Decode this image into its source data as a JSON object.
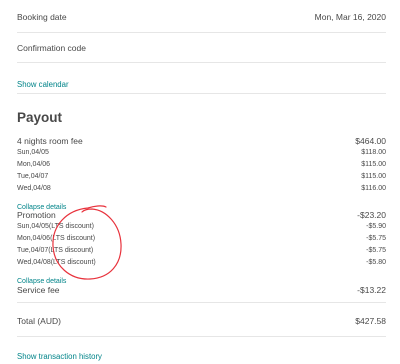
{
  "booking": {
    "date_label": "Booking date",
    "date_value": "Mon, Mar 16, 2020",
    "confirmation_label": "Confirmation code",
    "show_calendar": "Show calendar"
  },
  "payout": {
    "title": "Payout",
    "room_fee": {
      "label": "4 nights room fee",
      "value": "$464.00",
      "nights": [
        {
          "date": "Sun,04/05",
          "amount": "$118.00"
        },
        {
          "date": "Mon,04/06",
          "amount": "$115.00"
        },
        {
          "date": "Tue,04/07",
          "amount": "$115.00"
        },
        {
          "date": "Wed,04/08",
          "amount": "$116.00"
        }
      ],
      "collapse": "Collapse details"
    },
    "promotion": {
      "label": "Promotion",
      "value": "-$23.20",
      "items": [
        {
          "date": "Sun,04/05(LTS discount)",
          "amount": "-$5.90"
        },
        {
          "date": "Mon,04/06(LTS discount)",
          "amount": "-$5.75"
        },
        {
          "date": "Tue,04/07(LTS discount)",
          "amount": "-$5.75"
        },
        {
          "date": "Wed,04/08(LTS discount)",
          "amount": "-$5.80"
        }
      ],
      "collapse": "Collapse details"
    },
    "service_fee": {
      "label": "Service fee",
      "value": "-$13.22"
    },
    "total": {
      "label": "Total (AUD)",
      "value": "$427.58"
    },
    "history_link": "Show transaction history"
  },
  "colors": {
    "link": "#008489",
    "annotation": "#e8323c"
  }
}
